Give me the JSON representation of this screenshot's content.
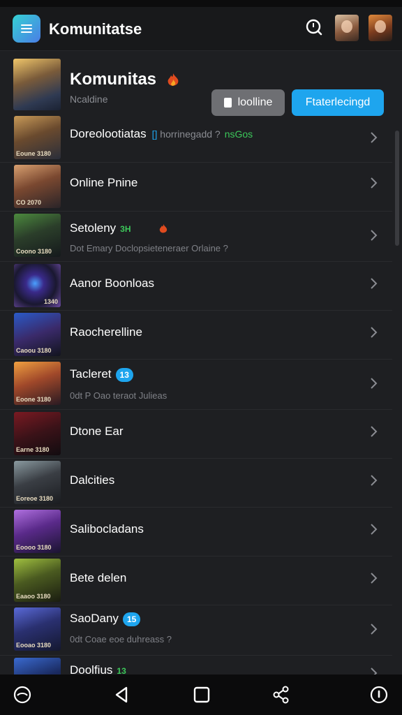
{
  "status": {
    "left": "",
    "right": ""
  },
  "app": {
    "title": "Komunitatse"
  },
  "header": {
    "title": "Komunitas",
    "subtitle": "Ncaldine",
    "button_outline": "loolline",
    "button_primary": "Ftaterlecingd"
  },
  "rows": [
    {
      "title": "Doreolootiatas",
      "hint_a": "[]",
      "hint_b": "horrinegadd ?",
      "hint_c": "nsGos",
      "subtitle": "",
      "tag": "Eoune 3180"
    },
    {
      "title": "Online Pnine",
      "subtitle": "",
      "tag": "CO 2070"
    },
    {
      "title": "Setoleny",
      "badge": "3H",
      "subtitle": "Dot Emary Doclopsieteneraer Orlaine ?",
      "tag": "Coono 3180"
    },
    {
      "title": "Aanor Boonloas",
      "subtitle": "",
      "tag": "1340"
    },
    {
      "title": "Raocherelline",
      "subtitle": "",
      "tag": "Caoou 3180"
    },
    {
      "title": "Tacleret",
      "badge": "13",
      "subtitle": "0dt P Oao teraot Julieas",
      "tag": "Eoone 3180"
    },
    {
      "title": "Dtone Ear",
      "subtitle": "",
      "tag": "Earne 3180"
    },
    {
      "title": "Dalcities",
      "subtitle": "",
      "tag": "Eoreoe 3180"
    },
    {
      "title": "Salibocladans",
      "subtitle": "",
      "tag": "Eoooo 3180"
    },
    {
      "title": "Bete delen",
      "subtitle": "",
      "tag": "Eaaoo 3180"
    },
    {
      "title": "SaoDany",
      "badge": "15",
      "subtitle": "0dt Coae eoe duhreass ?",
      "tag": "Eooao 3180"
    },
    {
      "title": "Doolfius",
      "badge": "13",
      "subtitle": "",
      "tag": ""
    }
  ],
  "colors": {
    "accent": "#1ea5ee",
    "green": "#3cc85a",
    "background": "#1e1f22"
  }
}
